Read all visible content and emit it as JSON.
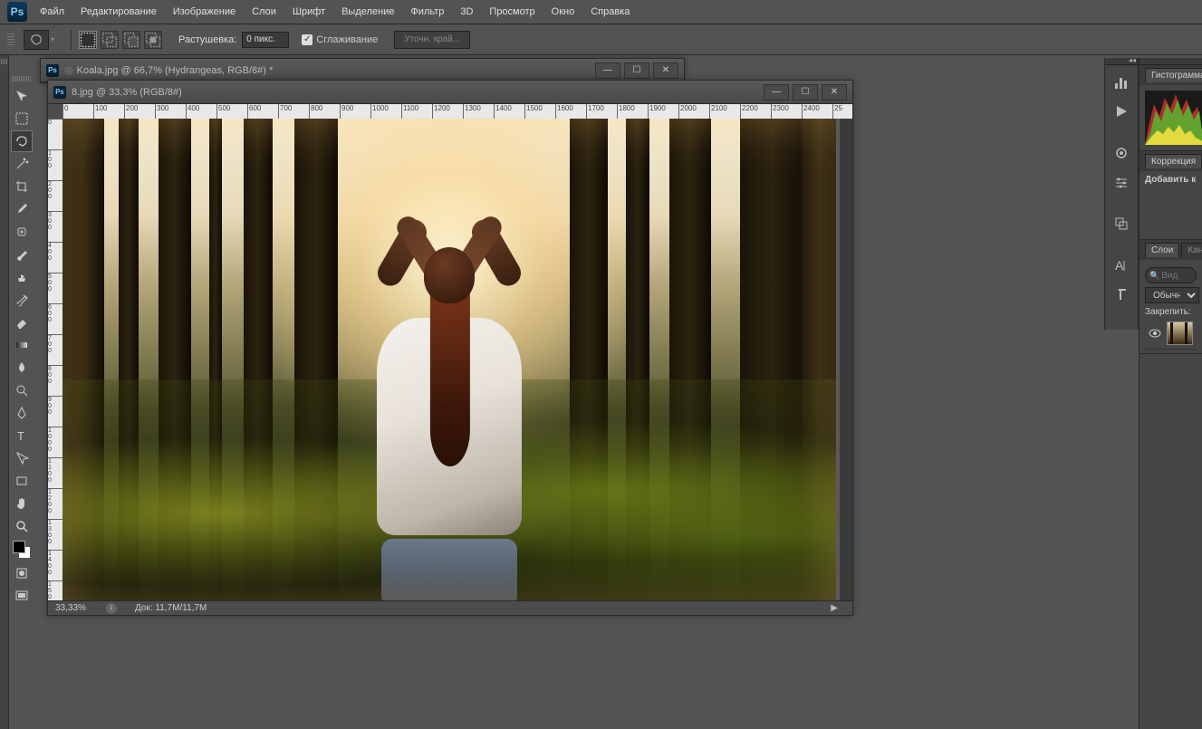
{
  "app": {
    "logo": "Ps"
  },
  "menu": [
    "Файл",
    "Редактирование",
    "Изображение",
    "Слои",
    "Шрифт",
    "Выделение",
    "Фильтр",
    "3D",
    "Просмотр",
    "Окно",
    "Справка"
  ],
  "options": {
    "feather_label": "Растушевка:",
    "feather_value": "0 пикс.",
    "antialias_label": "Сглаживание",
    "refine_label": "Уточн. край..."
  },
  "tools": [
    {
      "name": "move-tool"
    },
    {
      "name": "rect-marquee-tool"
    },
    {
      "name": "lasso-tool",
      "active": true
    },
    {
      "name": "magic-wand-tool"
    },
    {
      "name": "crop-tool"
    },
    {
      "name": "eyedropper-tool"
    },
    {
      "name": "healing-brush-tool"
    },
    {
      "name": "brush-tool"
    },
    {
      "name": "clone-stamp-tool"
    },
    {
      "name": "history-brush-tool"
    },
    {
      "name": "eraser-tool"
    },
    {
      "name": "gradient-tool"
    },
    {
      "name": "blur-tool"
    },
    {
      "name": "dodge-tool"
    },
    {
      "name": "pen-tool"
    },
    {
      "name": "type-tool"
    },
    {
      "name": "path-select-tool"
    },
    {
      "name": "rectangle-tool"
    },
    {
      "name": "hand-tool"
    },
    {
      "name": "zoom-tool"
    }
  ],
  "tools_extra": [
    {
      "name": "quick-mask-tool"
    },
    {
      "name": "screen-mode-tool"
    }
  ],
  "docs": {
    "inactive": {
      "title": "Koala.jpg @ 66,7% (Hydrangeas, RGB/8#) *"
    },
    "active": {
      "title": "8.jpg @ 33,3% (RGB/8#)",
      "zoom": "33,33%",
      "docinfo_label": "Док:",
      "docinfo": "11,7M/11,7M",
      "ruler_marks": [
        "0",
        "100",
        "200",
        "300",
        "400",
        "500",
        "600",
        "700",
        "800",
        "900",
        "1000",
        "1100",
        "1200",
        "1300",
        "1400",
        "1500",
        "1600",
        "1700",
        "1800",
        "1900",
        "2000",
        "2100",
        "2200",
        "2300",
        "2400",
        "25"
      ],
      "ruler_v": [
        "0",
        "100",
        "200",
        "300",
        "400",
        "500",
        "600",
        "700",
        "800",
        "900",
        "1000",
        "1100",
        "1200",
        "1300",
        "1400",
        "1500"
      ]
    }
  },
  "right_icons": [
    "histogram-icon",
    "play-icon",
    "brush-preset-icon",
    "adjust-icon",
    "clone-src-icon",
    "paragraph-align-icon",
    "character-icon",
    "paragraph-icon"
  ],
  "panels": {
    "histogram": {
      "tab": "Гистограмма"
    },
    "adjust": {
      "tab": "Коррекция",
      "add": "Добавить к"
    },
    "layers": {
      "tab1": "Слои",
      "tab2": "Кана",
      "search_placeholder": "Вид",
      "blend": "Обычные",
      "lock_label": "Закрепить:"
    }
  }
}
